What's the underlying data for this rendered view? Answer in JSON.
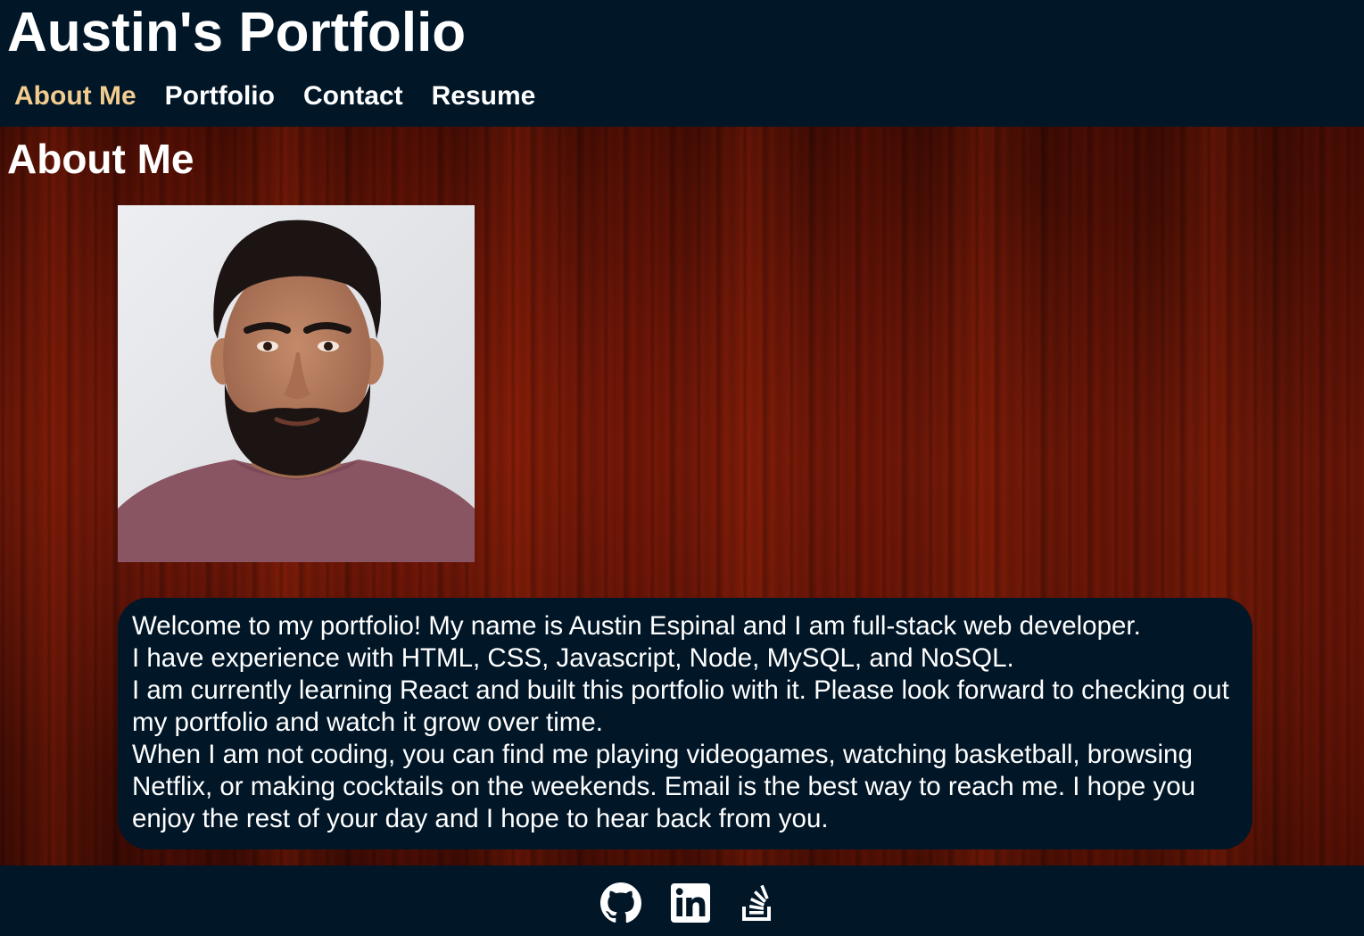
{
  "header": {
    "site_title": "Austin's Portfolio",
    "nav": [
      {
        "label": "About Me",
        "active": true
      },
      {
        "label": "Portfolio",
        "active": false
      },
      {
        "label": "Contact",
        "active": false
      },
      {
        "label": "Resume",
        "active": false
      }
    ]
  },
  "about": {
    "heading": "About Me",
    "bio": [
      "Welcome to my portfolio! My name is Austin Espinal and I am full-stack web developer.",
      "I have experience with HTML, CSS, Javascript, Node, MySQL, and NoSQL.",
      "I am currently learning React and built this portfolio with it. Please look forward to checking out my portfolio and watch it grow over time.",
      "When I am not coding, you can find me playing videogames, watching basketball, browsing Netflix, or making cocktails on the weekends. Email is the best way to reach me. I hope you enjoy the rest of your day and I hope to hear back from you."
    ]
  },
  "footer": {
    "social": [
      "github-icon",
      "linkedin-icon",
      "stackoverflow-icon"
    ]
  },
  "colors": {
    "header_bg": "#011627",
    "nav_active": "#f2cc8f",
    "card_bg": "#011627",
    "text": "#ffffff"
  }
}
